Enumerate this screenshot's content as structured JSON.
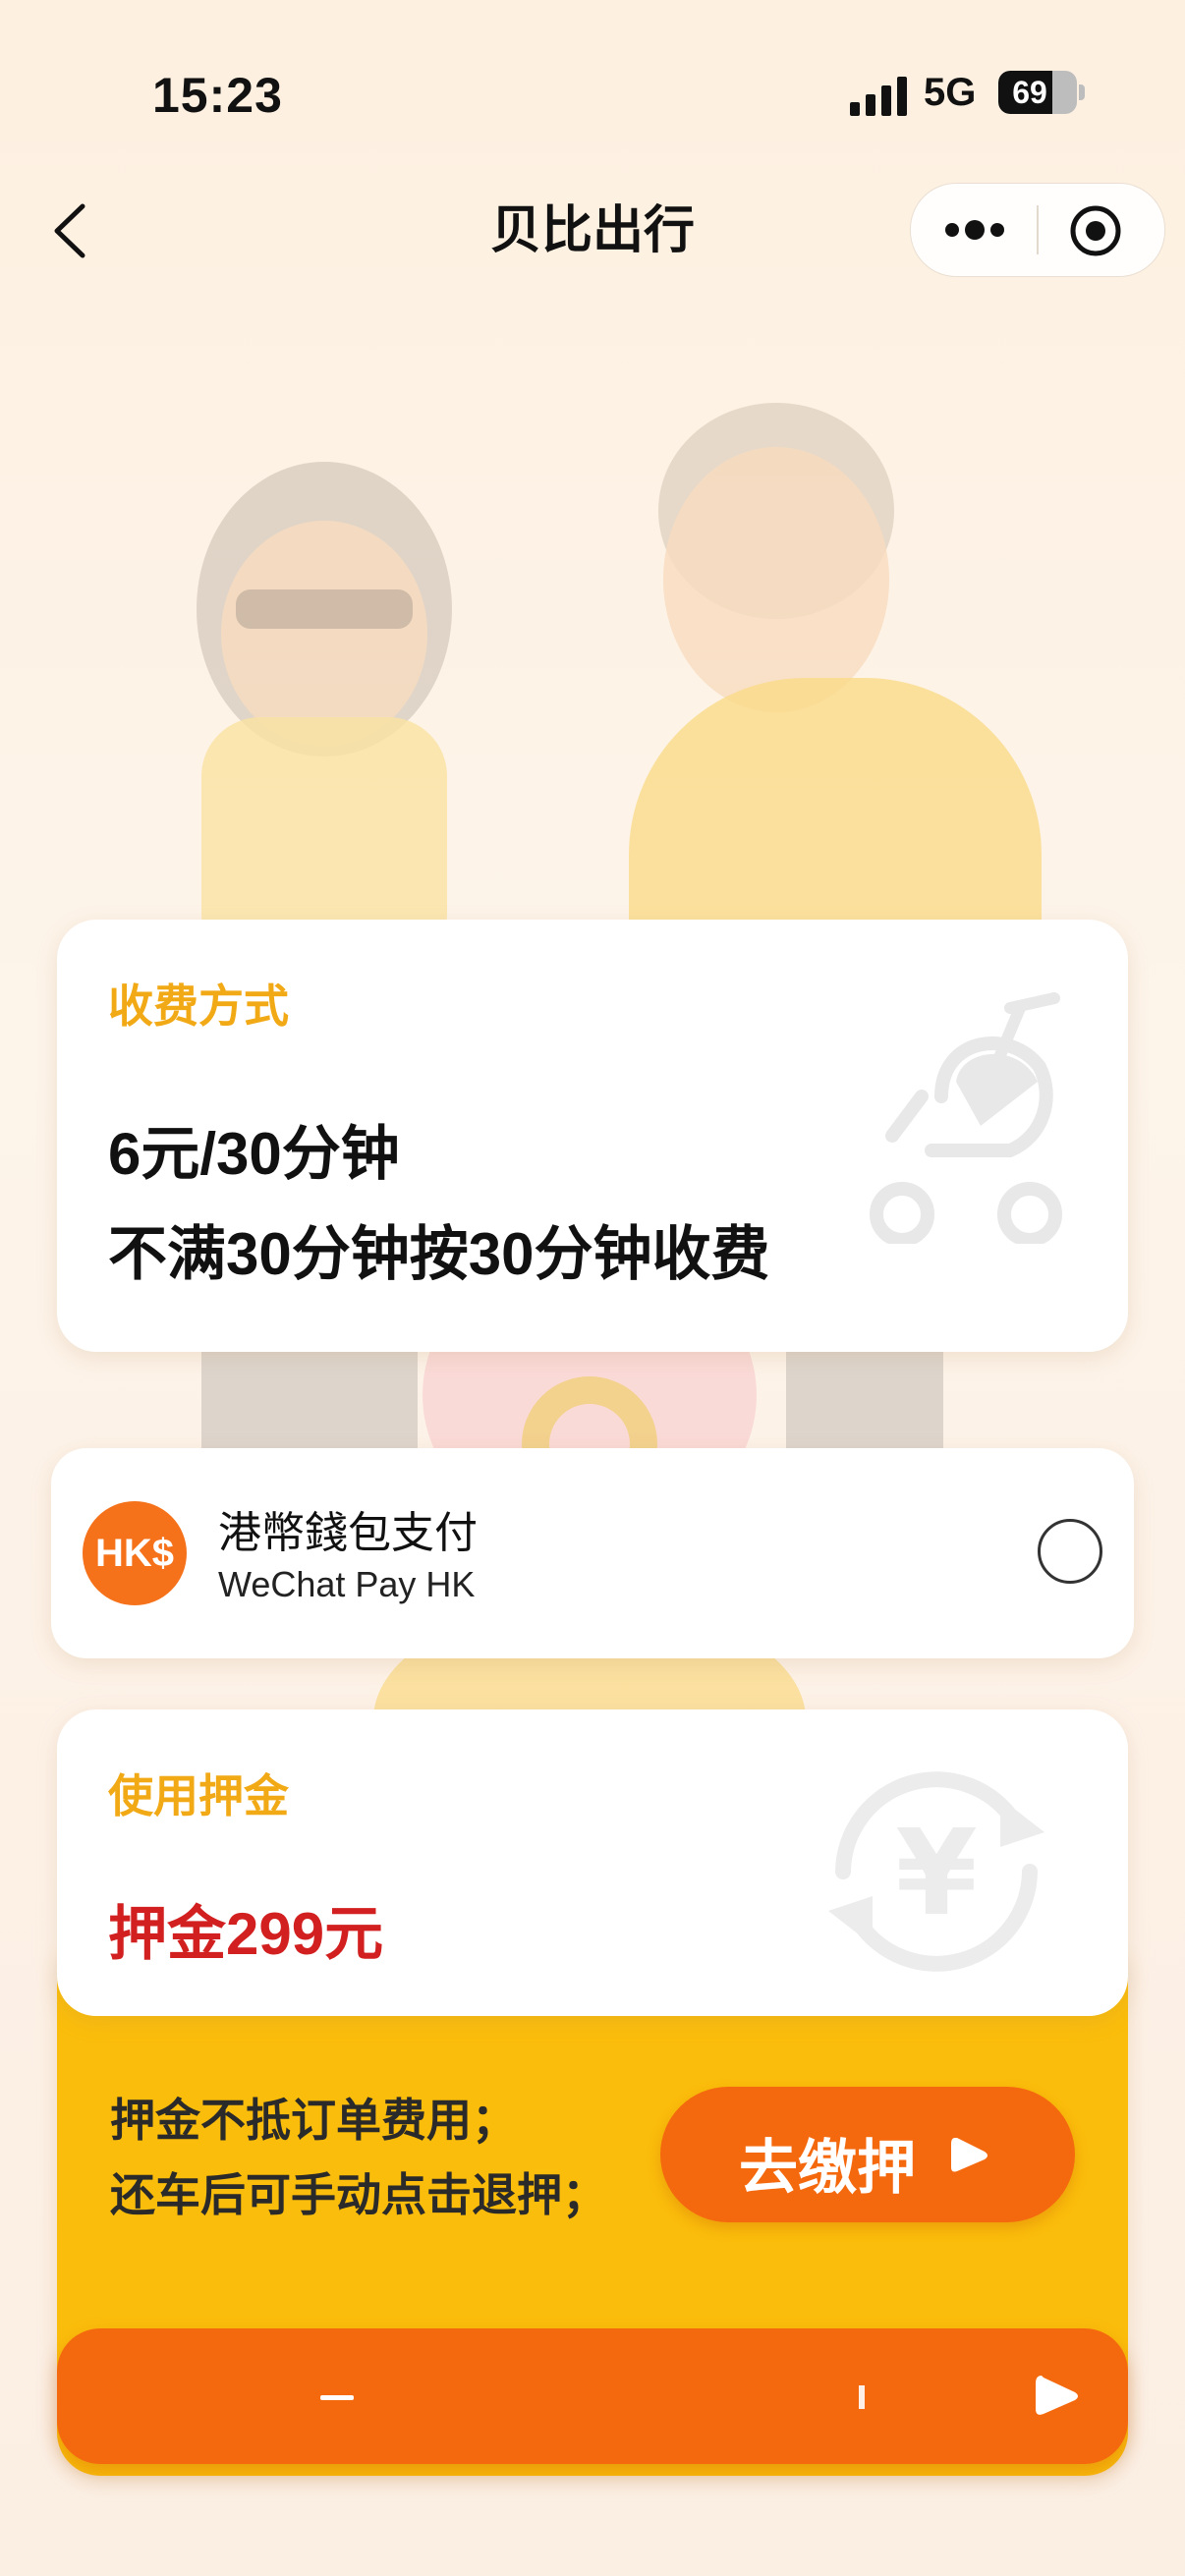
{
  "status_bar": {
    "time": "15:23",
    "network": "5G",
    "battery_level": "69",
    "battery_fraction": 0.69
  },
  "nav": {
    "title": "贝比出行"
  },
  "pricing_card": {
    "label": "收费方式",
    "rate": "6元/30分钟",
    "rule": "不满30分钟按30分钟收费"
  },
  "payment_method": {
    "logo_text": "HK$",
    "title": "港幣錢包支付",
    "subtitle": "WeChat Pay HK",
    "selected": false
  },
  "deposit_card": {
    "label": "使用押金",
    "amount": "押金299元"
  },
  "deposit_notes": {
    "line1": "押金不抵订单费用；",
    "line2": "还车后可手动点击退押；"
  },
  "deposit_button": {
    "label": "去缴押"
  },
  "colors": {
    "accent_yellow": "#f2a916",
    "orange": "#f5690e",
    "deposit_red": "#d21f1f",
    "panel_yellow": "#fbbd0b"
  }
}
